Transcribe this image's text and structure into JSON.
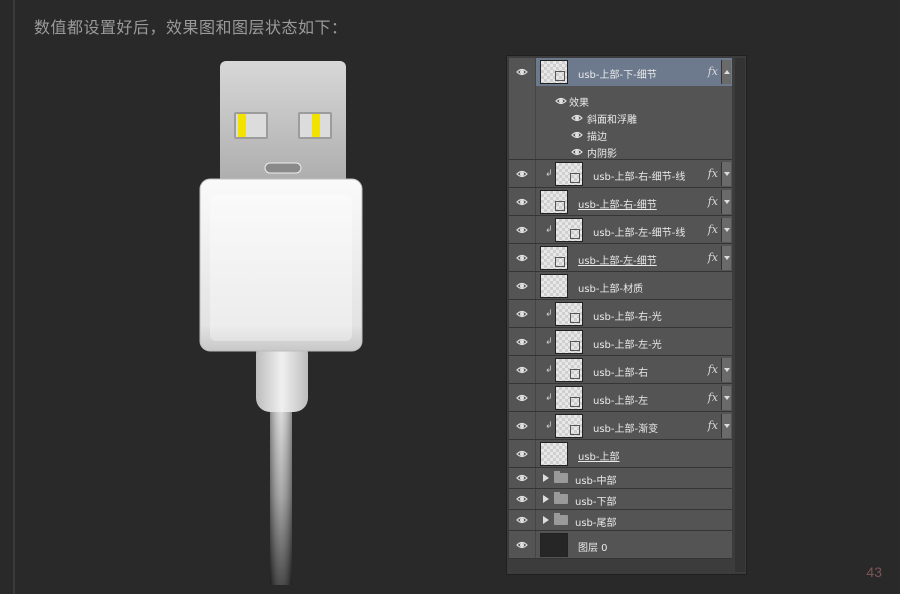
{
  "page": {
    "heading": "数值都设置好后，效果图和图层状态如下：",
    "page_number": "43"
  },
  "layers": {
    "selected": "usb-上部-下-细节",
    "effects_group": {
      "title": "效果",
      "items": [
        "斜面和浮雕",
        "描边",
        "内阴影"
      ]
    },
    "rows": [
      {
        "name": "usb-上部-下-细节",
        "clipped": false,
        "fx": true,
        "underline": false,
        "kind": "layer"
      },
      {
        "name": "usb-上部-右-细节-线",
        "clipped": true,
        "fx": true,
        "underline": false,
        "kind": "layer"
      },
      {
        "name": "usb-上部-右-细节",
        "clipped": false,
        "fx": true,
        "underline": true,
        "kind": "layer"
      },
      {
        "name": "usb-上部-左-细节-线",
        "clipped": true,
        "fx": true,
        "underline": false,
        "kind": "layer"
      },
      {
        "name": "usb-上部-左-细节",
        "clipped": false,
        "fx": true,
        "underline": true,
        "kind": "layer"
      },
      {
        "name": "usb-上部-材质",
        "clipped": false,
        "fx": false,
        "underline": false,
        "kind": "layer"
      },
      {
        "name": "usb-上部-右-光",
        "clipped": true,
        "fx": false,
        "underline": false,
        "kind": "layer"
      },
      {
        "name": "usb-上部-左-光",
        "clipped": true,
        "fx": false,
        "underline": false,
        "kind": "layer"
      },
      {
        "name": "usb-上部-右",
        "clipped": true,
        "fx": true,
        "underline": false,
        "kind": "layer"
      },
      {
        "name": "usb-上部-左",
        "clipped": true,
        "fx": true,
        "underline": false,
        "kind": "layer"
      },
      {
        "name": "usb-上部-渐变",
        "clipped": true,
        "fx": true,
        "underline": false,
        "kind": "layer"
      },
      {
        "name": "usb-上部",
        "clipped": false,
        "fx": false,
        "underline": true,
        "kind": "layer"
      },
      {
        "name": "usb-中部",
        "kind": "folder"
      },
      {
        "name": "usb-下部",
        "kind": "folder"
      },
      {
        "name": "usb-尾部",
        "kind": "folder"
      },
      {
        "name": "图层 0",
        "kind": "background"
      }
    ],
    "fx_label": "fx",
    "clip_glyph": "↲",
    "icons": {
      "visibility": "eye-icon",
      "folder": "folder-icon",
      "expand": "triangle-right-icon"
    }
  },
  "colors": {
    "background": "#292929",
    "panel_row": "#545454",
    "selected_row": "#6d7a8e",
    "usb_accent": "#f2e200"
  }
}
